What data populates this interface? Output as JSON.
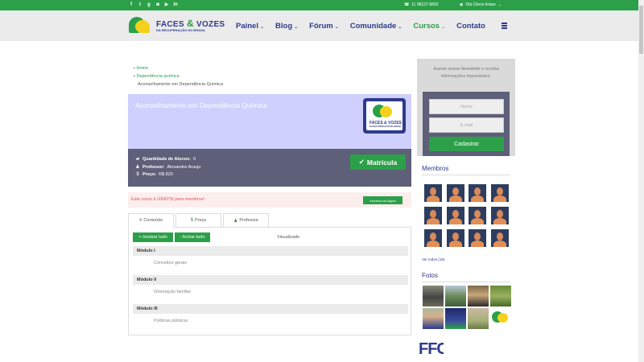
{
  "topbar": {
    "social_icons": [
      "facebook-icon",
      "twitter-icon",
      "google-plus-icon",
      "instagram-icon",
      "youtube-icon",
      "linkedin-icon"
    ],
    "social_glyphs": [
      "f",
      "t",
      "g",
      "◙",
      "▶",
      "in"
    ],
    "phone": "11 98127-6802",
    "greeting": "Olá Clecio Antao"
  },
  "header": {
    "logo_text": "FACES",
    "logo_amp": "&",
    "logo_text2": "VOZES",
    "logo_sub": "DA RECUPERAÇÃO NO BRASIL",
    "nav": [
      {
        "label": "Painel",
        "chevron": "⌄"
      },
      {
        "label": "Blog",
        "chevron": "⌄"
      },
      {
        "label": "Fórum",
        "chevron": "⌄"
      },
      {
        "label": "Comunidade",
        "chevron": "⌄"
      },
      {
        "label": "Cursos",
        "chevron": "⌄"
      },
      {
        "label": "Contato",
        "chevron": ""
      }
    ]
  },
  "breadcrumb": {
    "home": "Home",
    "category": "Dependência química",
    "current": "Aconselhamento em Dependência Química"
  },
  "course": {
    "title": "Aconselhamento em Dependência Química",
    "logo_text": "FACES & VOZES",
    "logo_sub": "DA RECUPERAÇÃO NO BRASIL",
    "students_label": "Quantidade de Alunos:",
    "students_value": "0",
    "teacher_label": "Professor:",
    "teacher_value": "Alexandre Araujo",
    "price_label": "Preço:",
    "price_value": "R$ 820",
    "enroll_label": "Matrícula",
    "free_text": "Este curso é GRÁTIS para membros!",
    "free_button": "Inscreva-se Agora"
  },
  "tabs": [
    {
      "label": "Conteúdo",
      "icon": "≡"
    },
    {
      "label": "Preço",
      "icon": "$"
    },
    {
      "label": "Professor",
      "icon": "♟"
    }
  ],
  "content": {
    "show_all": "+ mostrar tudo",
    "close_all": "- fechar tudo",
    "viewed": "Visualizado",
    "modules": [
      {
        "title": "Módulo I",
        "lesson": "Conceitos gerais"
      },
      {
        "title": "Módulo II",
        "lesson": "Orientação familiar"
      },
      {
        "title": "Módulo III",
        "lesson": "Políticas públicas"
      }
    ]
  },
  "sidebar": {
    "newsletter_text": "Assine nossa Newslette e receba informações importantes.",
    "name_placeholder": "Nome",
    "email_placeholder": "E-mail",
    "submit": "Cadastrar",
    "members_title": "Membros",
    "see_all": "Ver todos (18)",
    "photos_title": "Fotos",
    "partial_logo_text": "FFC"
  },
  "colors": {
    "brand_green": "#2ca049",
    "brand_blue": "#2d3a8c",
    "banner_bg": "#cfd0fd",
    "info_bg": "#5e5f78"
  }
}
